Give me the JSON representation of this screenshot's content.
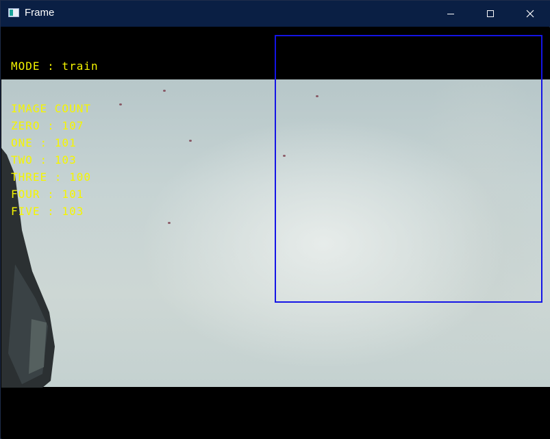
{
  "window": {
    "title": "Frame",
    "controls": {
      "minimize_icon": "minimize-icon",
      "maximize_icon": "maximize-icon",
      "close_icon": "close-icon"
    }
  },
  "overlay": {
    "mode_label": "MODE : train",
    "count_heading": "IMAGE COUNT",
    "counts": [
      "ZERO : 107",
      "ONE : 101",
      "TWO : 103",
      "THREE : 100",
      "FOUR : 101",
      "FIVE : 103"
    ],
    "text_color": "#f5f500",
    "roi_color": "#1414e6"
  },
  "colors": {
    "titlebar": "#0a1f44",
    "letterbox": "#000000"
  }
}
